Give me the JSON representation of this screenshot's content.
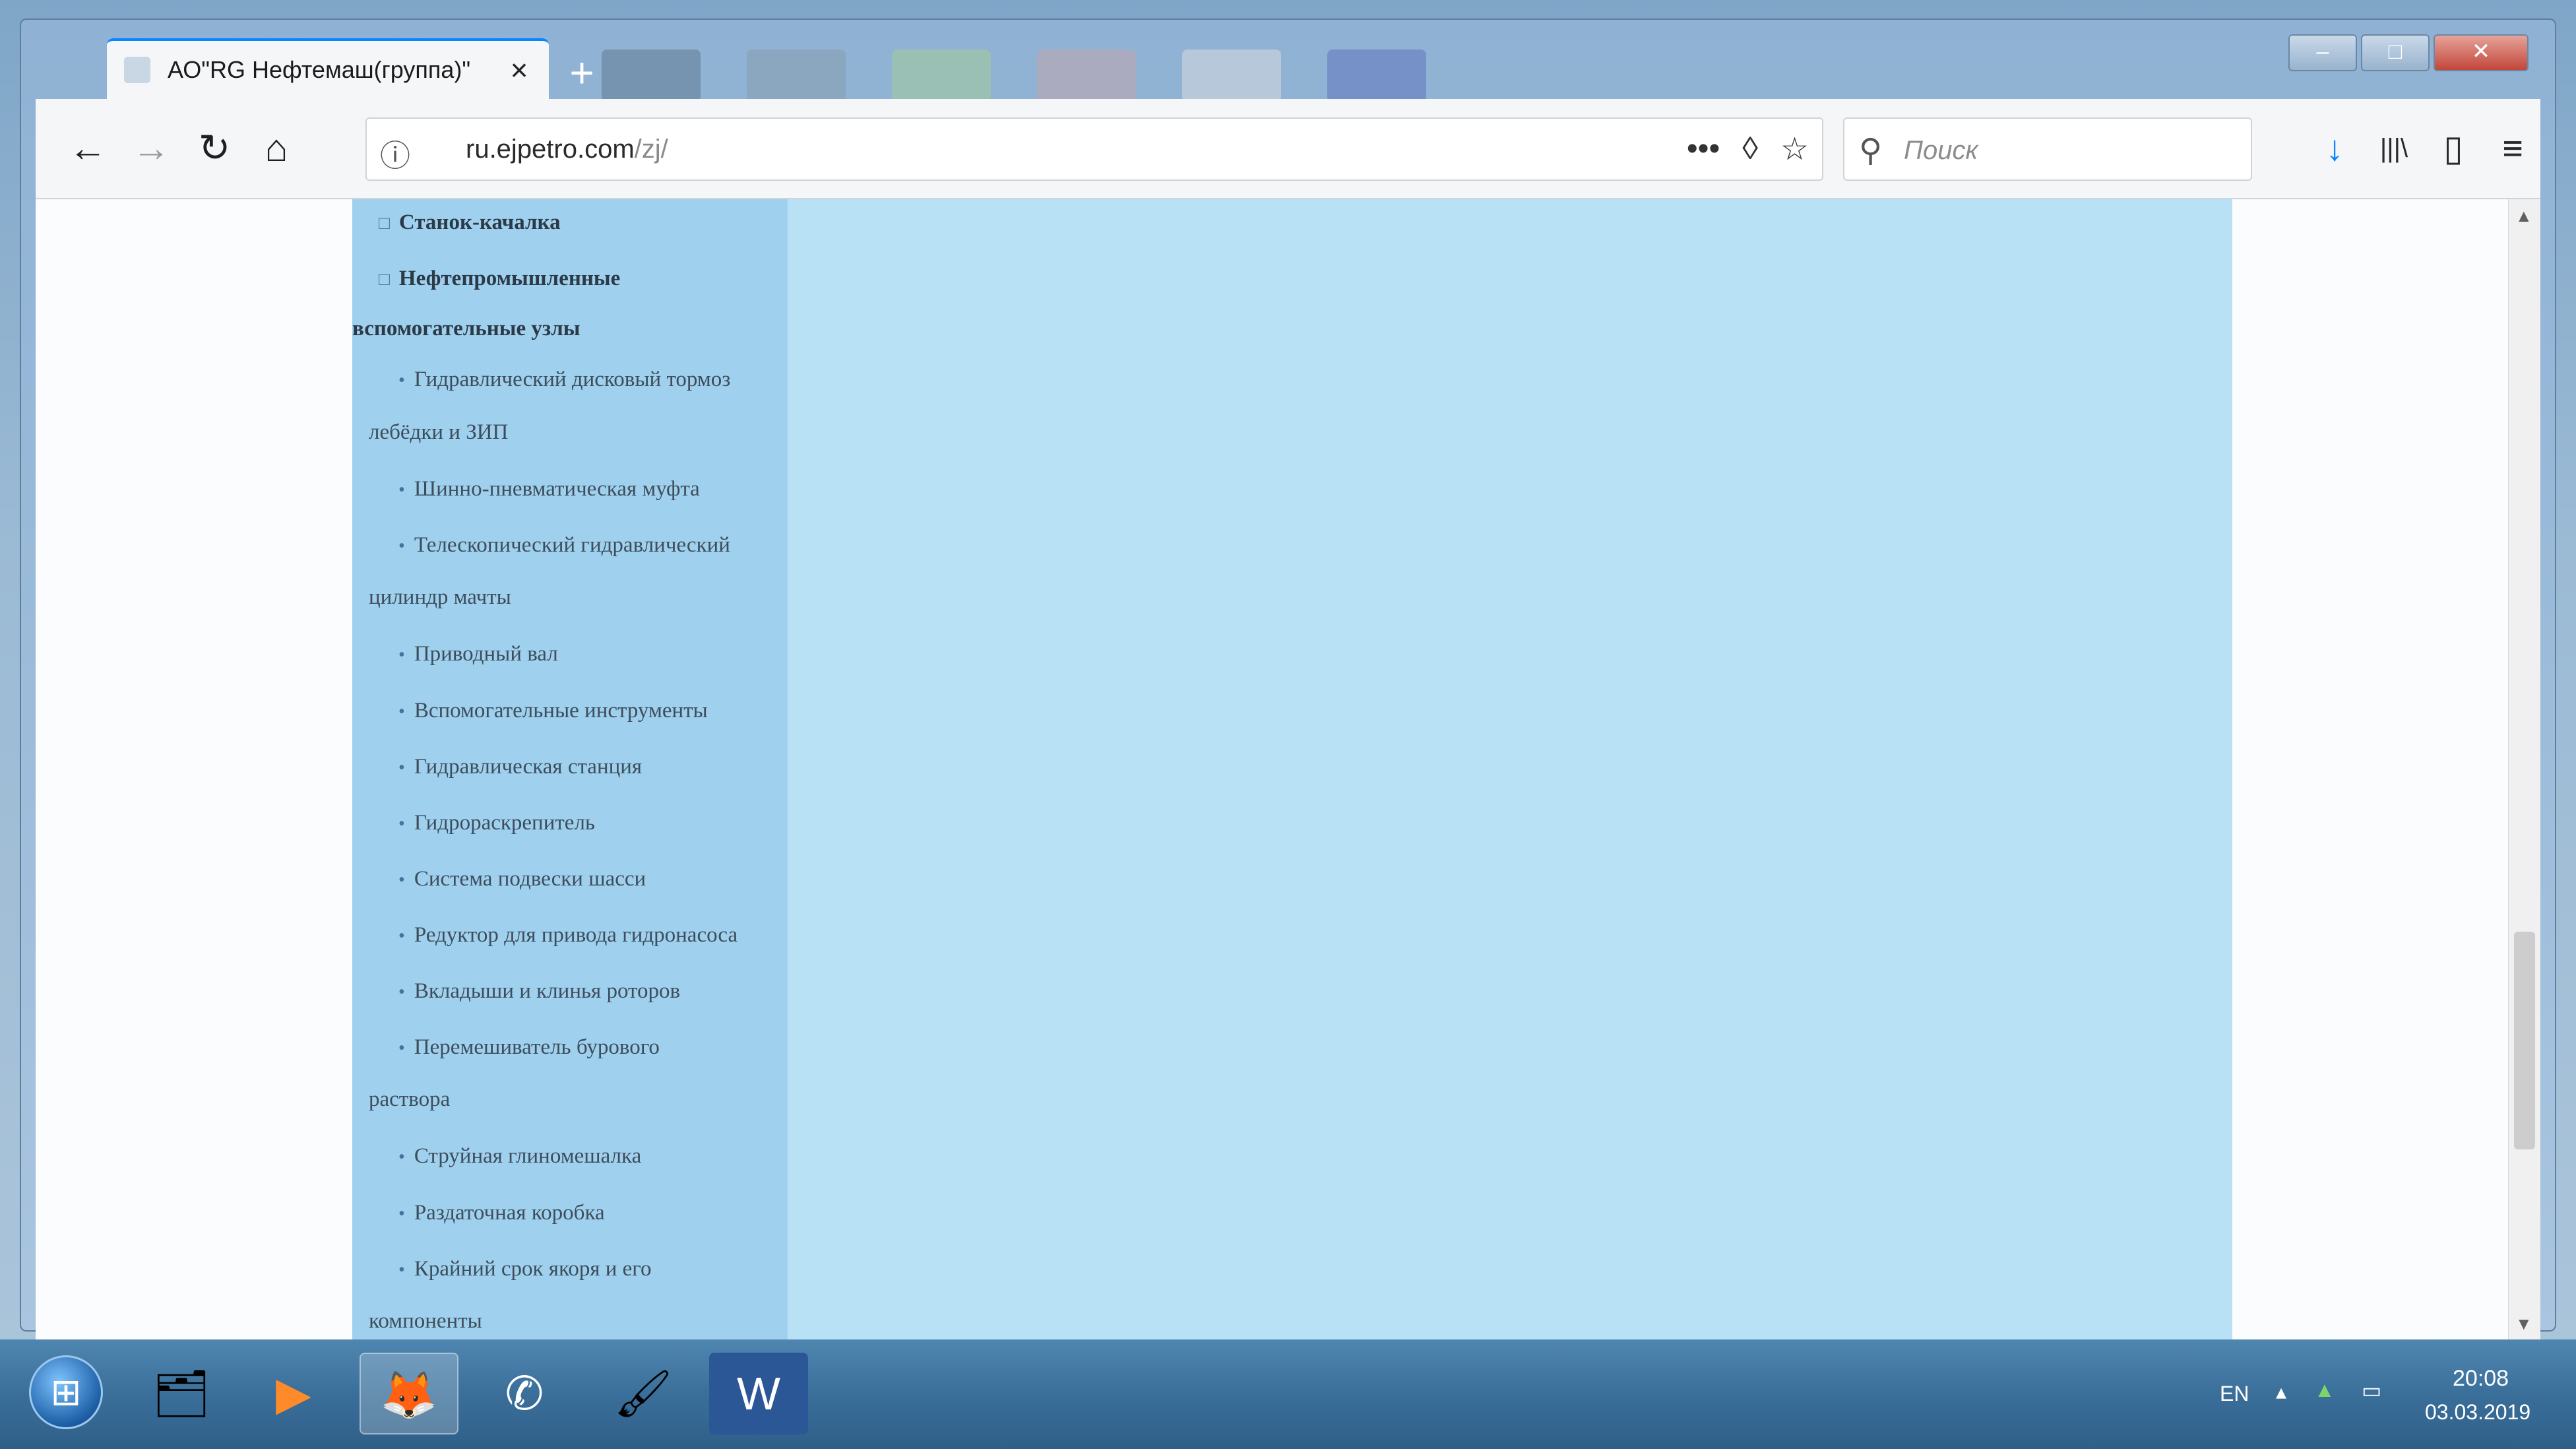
{
  "browser": {
    "tab_title": "АО\"RG Нефтемаш(группа)\"",
    "tab_close": "×",
    "new_tab": "+",
    "window_buttons": {
      "minimize": "–",
      "maximize": "□",
      "close": "✕"
    }
  },
  "nav": {
    "back": "←",
    "forward": "→",
    "reload": "↻",
    "home": "⌂",
    "url_host": "ru.ejpetro.com",
    "url_path": "/zj/",
    "url_info_icon": "ⓘ",
    "more_actions": "•••",
    "pocket": "◊",
    "bookmark_star": "☆",
    "search_placeholder": "Поиск",
    "search_icon": "⚲",
    "downloads": "↓",
    "library": "|||\\",
    "sidebar_toggle": "▯",
    "menu": "≡"
  },
  "sidebar_menu": {
    "headings": [
      "Станок-качалка",
      "Нефтепромышленные",
      "вспомогательные узлы"
    ],
    "items": [
      "Гидравлический дисковый тормоз",
      "лебёдки и ЗИП",
      "Шинно-пневматическая муфта",
      "Телескопический гидравлический",
      "цилиндр мачты",
      "Приводный вал",
      "Вспомогательные инструменты",
      "Гидравлическая станция",
      "Гидрораскрепитель",
      "Система подвески шасси",
      "Редуктор для привода гидронасоса",
      "Вкладыши и клинья роторов",
      "Перемешиватель бурового",
      "раствора",
      "Струйная глиномешалка",
      "Раздаточная коробка",
      "Крайний срок якоря и его",
      "компоненты"
    ],
    "heading_bullet": "□",
    "item_bullet": "•"
  },
  "taskbar": {
    "start": "⊞",
    "language": "EN",
    "tray_arrow": "▴",
    "time": "20:08",
    "date": "03.03.2019"
  },
  "colors": {
    "sidebar_bg": "#9fd1ee",
    "main_bg": "#b9e1f5",
    "accent": "#0a84ff"
  }
}
